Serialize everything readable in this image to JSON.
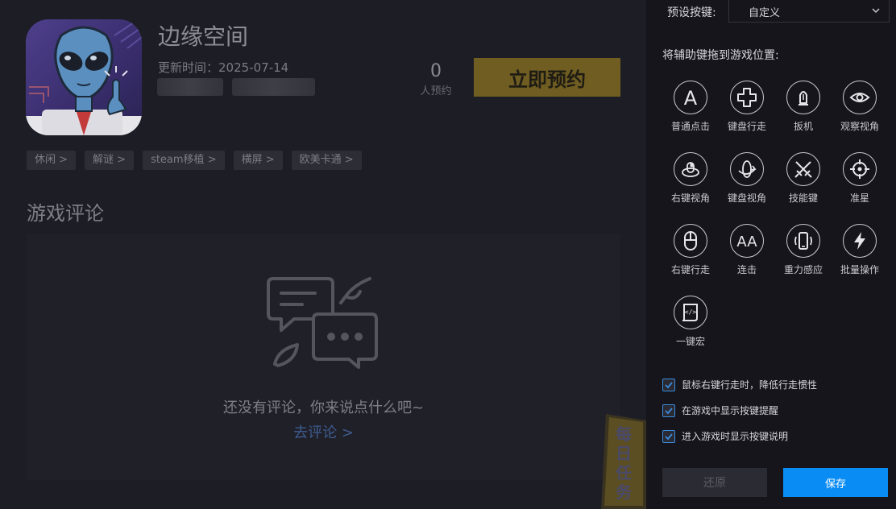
{
  "game": {
    "title": "边缘空间",
    "update_label": "更新时间：",
    "update_date": "2025-07-14",
    "reserve_count": "0",
    "reserve_label": "人预约",
    "reserve_button": "立即预约",
    "tags": [
      "休闲 >",
      "解谜 >",
      "steam移植 >",
      "横屏 >",
      "欧美卡通 >"
    ]
  },
  "comments": {
    "section_title": "游戏评论",
    "empty_text": "还没有评论，你来说点什么吧~",
    "go_comment": "去评论 >"
  },
  "daily_task": {
    "badge_text": "每日任务"
  },
  "key_panel": {
    "preset_label": "预设按键:",
    "preset_value": "自定义",
    "drag_hint": "将辅助键拖到游戏位置:",
    "keys": [
      {
        "label": "普通点击",
        "icon": "letter-a-icon"
      },
      {
        "label": "键盘行走",
        "icon": "dpad-icon"
      },
      {
        "label": "扳机",
        "icon": "trigger-icon"
      },
      {
        "label": "观察视角",
        "icon": "eye-icon"
      },
      {
        "label": "右键视角",
        "icon": "mouse-view-icon"
      },
      {
        "label": "键盘视角",
        "icon": "rotate-view-icon"
      },
      {
        "label": "技能键",
        "icon": "crossed-swords-icon"
      },
      {
        "label": "准星",
        "icon": "crosshair-icon"
      },
      {
        "label": "右键行走",
        "icon": "mouse-icon"
      },
      {
        "label": "连击",
        "icon": "double-a-icon"
      },
      {
        "label": "重力感应",
        "icon": "phone-tilt-icon"
      },
      {
        "label": "批量操作",
        "icon": "lightning-icon"
      },
      {
        "label": "一键宏",
        "icon": "macro-icon"
      }
    ],
    "options": [
      {
        "label": "鼠标右键行走时，降低行走惯性",
        "checked": true
      },
      {
        "label": "在游戏中显示按键提醒",
        "checked": true
      },
      {
        "label": "进入游戏时显示按键说明",
        "checked": true
      }
    ],
    "restore_button": "还原",
    "save_button": "保存"
  },
  "colors": {
    "accent_blue": "#0a8cf5",
    "reserve_gold": "#6f5d21",
    "panel_bg": "#15151b"
  }
}
